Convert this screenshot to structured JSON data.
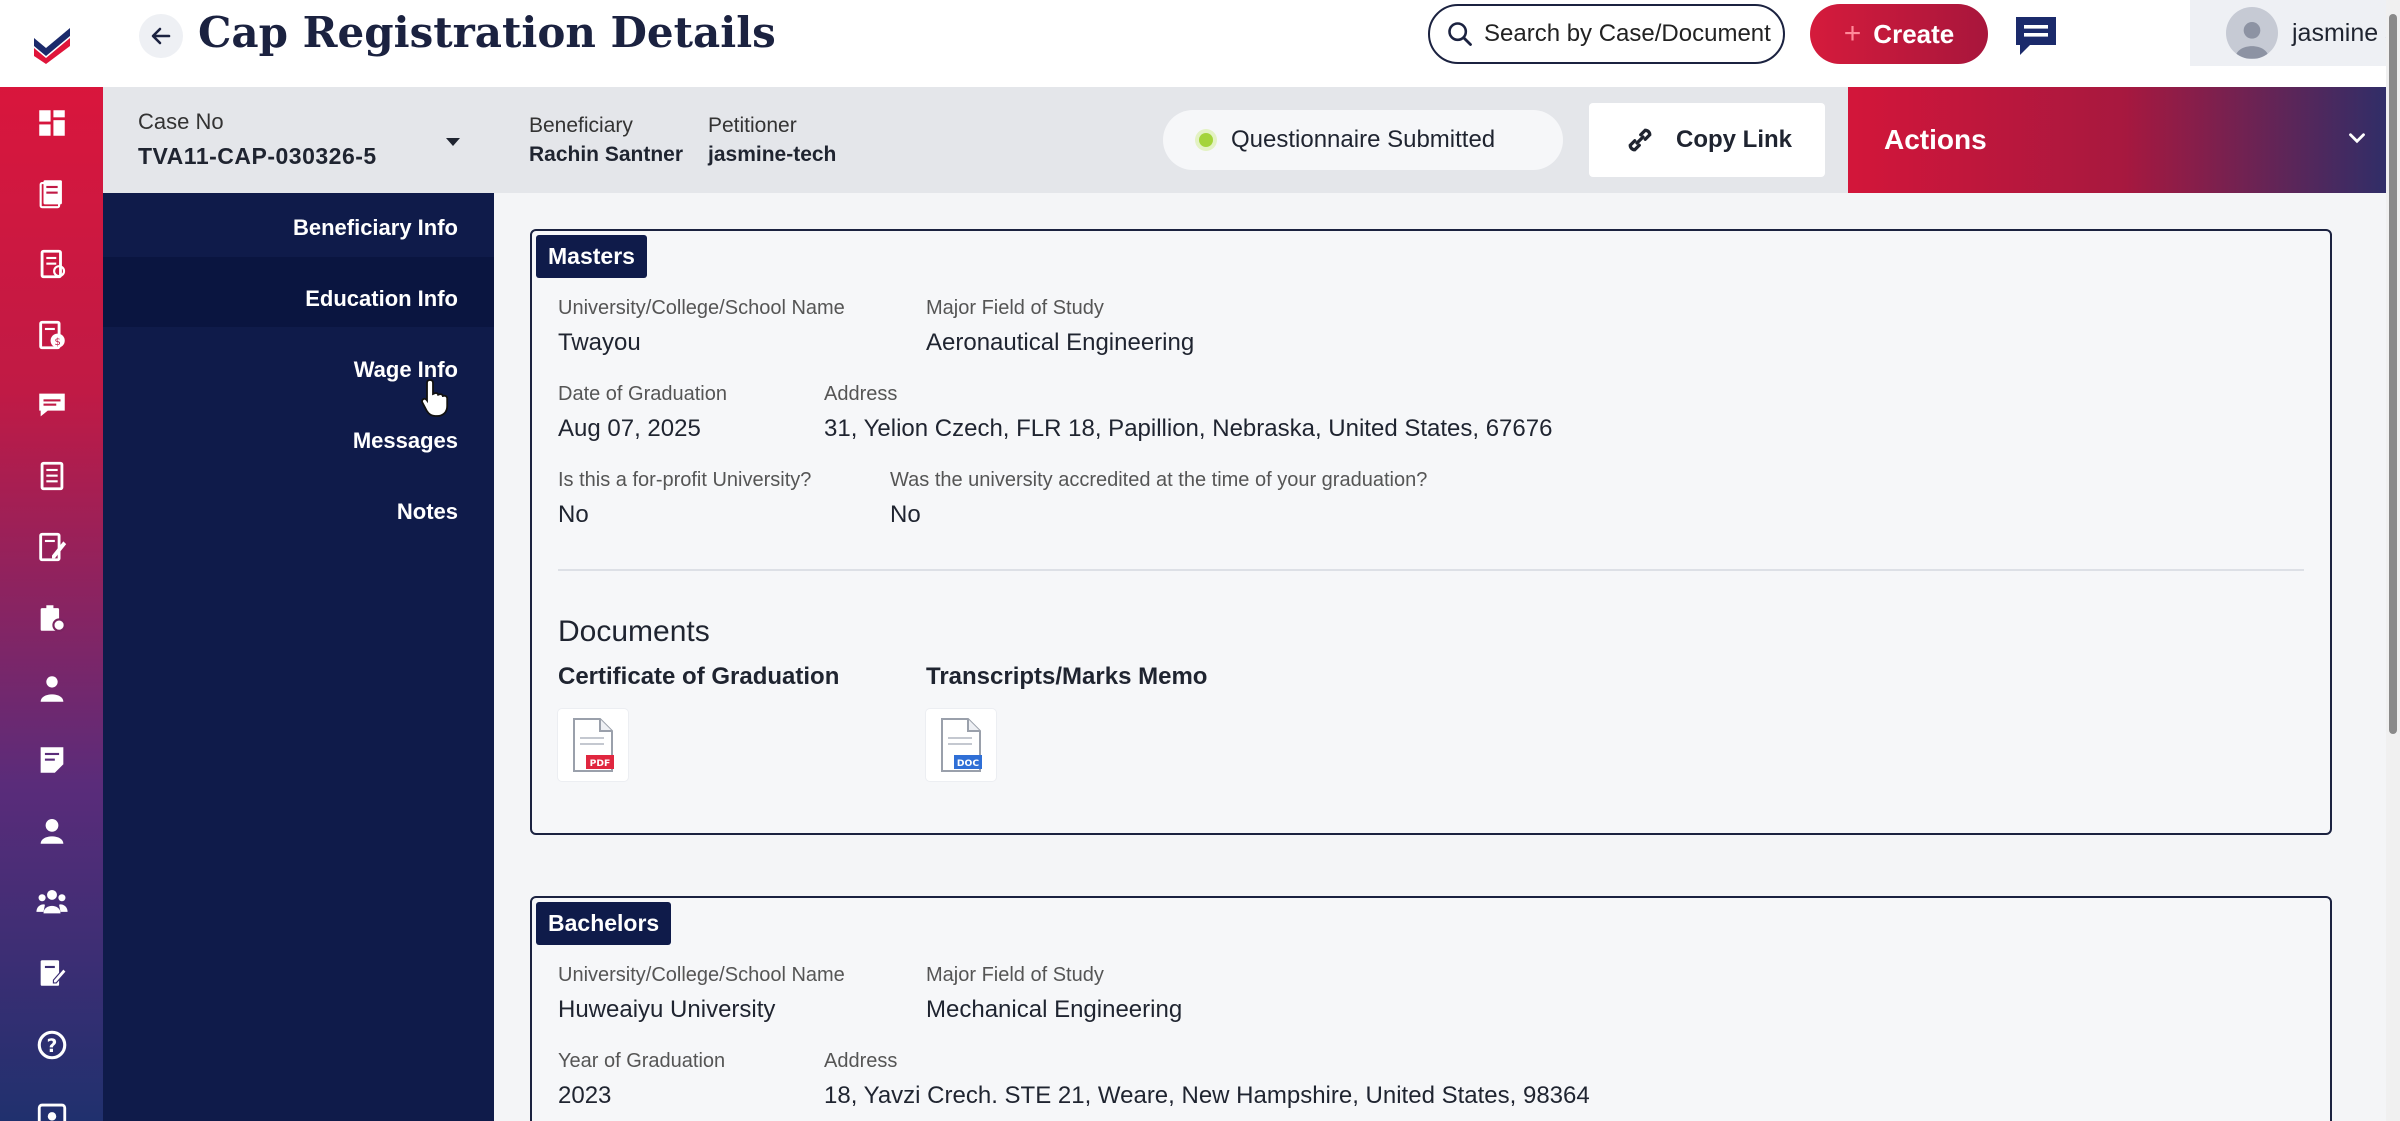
{
  "header": {
    "title": "Cap Registration Details",
    "search_placeholder": "Search by Case/Document",
    "create_label": "Create",
    "user_name": "jasmine s"
  },
  "case_strip": {
    "case_label": "Case No",
    "case_value": "TVA11-CAP-030326-5",
    "beneficiary_label": "Beneficiary",
    "beneficiary_value": "Rachin Santner",
    "petitioner_label": "Petitioner",
    "petitioner_value": "jasmine-tech",
    "status": "Questionnaire Submitted",
    "status_color": "#a4d43a",
    "copy_link_label": "Copy Link",
    "actions_label": "Actions"
  },
  "sidenav": {
    "items": [
      {
        "label": "Beneficiary Info"
      },
      {
        "label": "Education Info"
      },
      {
        "label": "Wage Info"
      },
      {
        "label": "Messages"
      },
      {
        "label": "Notes"
      }
    ],
    "active": "Education Info"
  },
  "rail_icons": [
    "dashboard-icon",
    "documents-icon",
    "forms-icon",
    "billing-icon",
    "chat-icon",
    "book-icon",
    "edit-icon",
    "case-icon",
    "person-icon",
    "notes-icon",
    "user-support-icon",
    "team-icon",
    "review-icon",
    "help-icon",
    "settings-icon"
  ],
  "masters": {
    "tag": "Masters",
    "school_label": "University/College/School Name",
    "school_value": "Twayou",
    "major_label": "Major Field of Study",
    "major_value": "Aeronautical Engineering",
    "grad_label": "Date of Graduation",
    "grad_value": "Aug 07, 2025",
    "address_label": "Address",
    "address_value": "31, Yelion Czech, FLR 18, Papillion, Nebraska, United States, 67676",
    "profit_label": "Is this a for-profit University?",
    "profit_value": "No",
    "accredited_label": "Was the university accredited at the time of your graduation?",
    "accredited_value": "No",
    "documents_title": "Documents",
    "documents": [
      {
        "name": "Certificate of Graduation",
        "type": "PDF"
      },
      {
        "name": "Transcripts/Marks Memo",
        "type": "DOC"
      }
    ]
  },
  "bachelors": {
    "tag": "Bachelors",
    "school_label": "University/College/School Name",
    "school_value": "Huweaiyu University",
    "major_label": "Major Field of Study",
    "major_value": "Mechanical Engineering",
    "grad_label": "Year of Graduation",
    "grad_value": "2023",
    "address_label": "Address",
    "address_value": "18, Yavzi Crech. STE 21, Weare, New Hampshire, United States, 98364"
  }
}
